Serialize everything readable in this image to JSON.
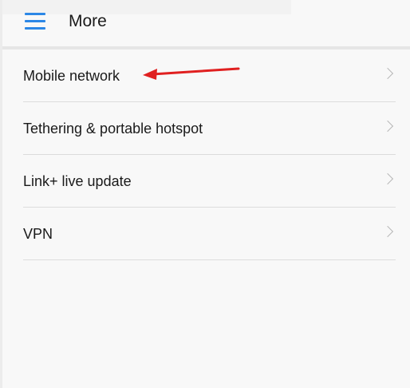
{
  "header": {
    "title": "More",
    "menu_icon": "hamburger-menu-icon",
    "accent_color": "#2c87e6"
  },
  "list": {
    "items": [
      {
        "label": "Mobile network",
        "icon": "chevron-right-icon"
      },
      {
        "label": "Tethering & portable hotspot",
        "icon": "chevron-right-icon"
      },
      {
        "label": "Link+ live update",
        "icon": "chevron-right-icon"
      },
      {
        "label": "VPN",
        "icon": "chevron-right-icon"
      }
    ]
  },
  "annotation": {
    "arrow_color": "#e02020",
    "points_to": "Mobile network"
  }
}
